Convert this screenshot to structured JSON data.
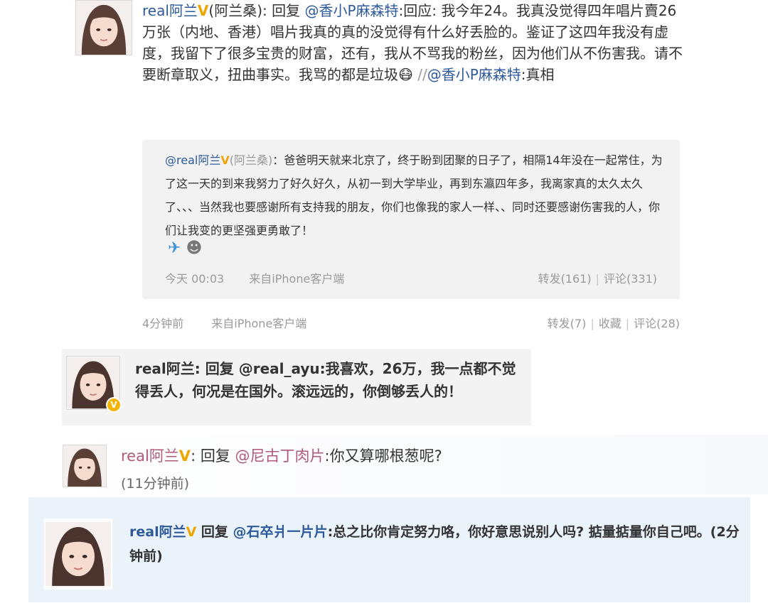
{
  "post1": {
    "author": "real阿兰",
    "v_badge": "V",
    "alias": "(阿兰桑)",
    "reply_prefix": ": 回复",
    "mention": "@香小P麻森特",
    "text": ":回应: 我今年24。我真没觉得四年唱片賣26万张（内地、香港）唱片我真的真的没觉得有什么好丢脸的。鉴证了这四年我没有虚度，我留下了很多宝贵的财富，还有，我从不骂我的粉丝，因为他们从不伤害我。请不要断章取义，扭曲事实。我骂的都是垃圾",
    "emoji": "😷",
    "repost_prefix": " //",
    "repost_mention": "@香小P麻森特",
    "repost_suffix": ":真相",
    "quoted": {
      "author": "@real阿兰",
      "v_badge": "V",
      "alias": "(阿兰桑)",
      "text": "：爸爸明天就来北京了，终于盼到团聚的日子了，相隔14年没在一起常住，为了这一天的到来我努力了好久好久，从初一到大学毕业，再到东瀛四年多，我离家真的太久太久了、、、当然我也要感谢所有支持我的朋友，你们也像我的家人一样、、同时还要感谢伤害我的人，你们让我变的更坚强更勇敢了！",
      "icon1": "✈",
      "icon2": "☻",
      "time": "今天 00:03",
      "source": "来自iPhone客户端",
      "repost": "转发(161)",
      "comment": "评论(331)"
    },
    "time": "4分钟前",
    "source": "来自iPhone客户端",
    "repost": "转发(7)",
    "favorite": "收藏",
    "comment": "评论(28)"
  },
  "comment2": {
    "author": "real阿兰",
    "v_badge": "V",
    "text": ": 回复 @real_ayu:我喜欢，26万，我一点都不觉得丢人，何况是在国外。滚远远的，你倒够丢人的！"
  },
  "comment3": {
    "author": "real阿兰",
    "v_badge": "V",
    "reply_prefix": ": 回复 ",
    "mention": "@尼古丁肉片",
    "text": ":你又算哪根葱呢?",
    "time": "(11分钟前)"
  },
  "comment4": {
    "author": "real阿兰",
    "v_badge": "V",
    "reply_prefix": " 回复 ",
    "mention": "@石卒爿一片片",
    "text": ":总之比你肯定努力咯，你好意思说别人吗? 掂量掂量你自己吧。(2分钟前)"
  },
  "colors": {
    "link": "#2e5a9c",
    "v_badge": "#f0a400",
    "meta": "#9a9a9a",
    "quote_bg": "#f2f2f2",
    "comment4_bg": "#eaf3fa"
  }
}
